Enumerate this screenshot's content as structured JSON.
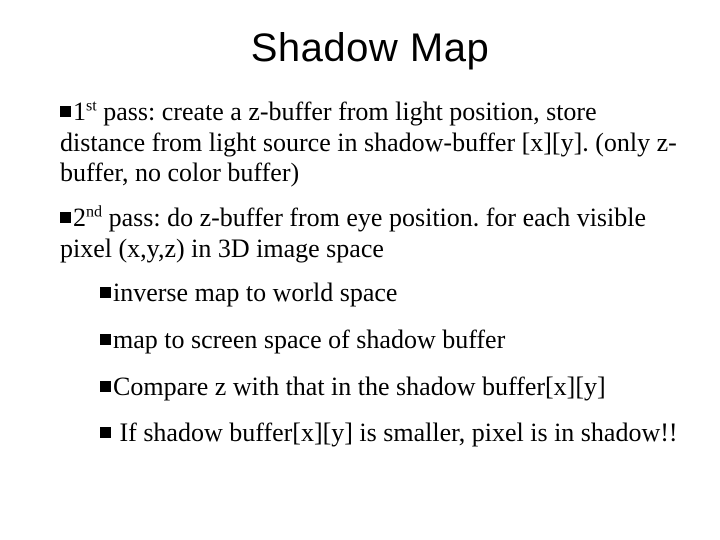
{
  "title": "Shadow Map",
  "bullets": {
    "b1_pre": "1",
    "b1_sup": "st",
    "b1_post": " pass: create a z-buffer from light position, store distance from light source in shadow-buffer [x][y]. (only z-buffer, no color buffer)",
    "b2_pre": "2",
    "b2_sup": "nd",
    "b2_post": " pass: do z-buffer from eye position. for each visible pixel (x,y,z) in 3D image space",
    "s1": "inverse map to world space",
    "s2": "map to screen space of shadow buffer",
    "s3": "Compare z with that in the shadow buffer[x][y]",
    "s4": " If shadow buffer[x][y] is smaller, pixel is in shadow!!"
  }
}
